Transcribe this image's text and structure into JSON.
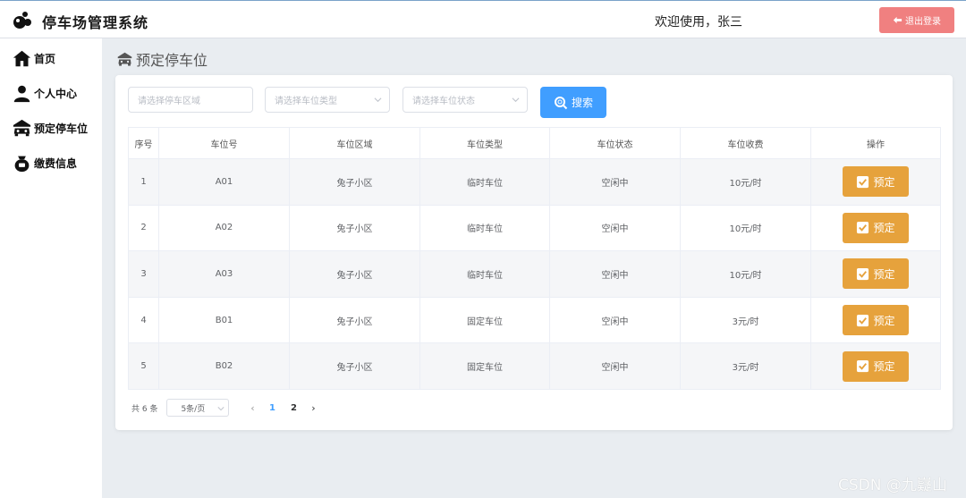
{
  "header": {
    "title": "停车场管理系统",
    "welcome": "欢迎使用，张三",
    "logout_label": "退出登录"
  },
  "sidebar": {
    "items": [
      {
        "label": "首页",
        "icon": "home-icon"
      },
      {
        "label": "个人中心",
        "icon": "user-icon"
      },
      {
        "label": "预定停车位",
        "icon": "car-icon"
      },
      {
        "label": "缴费信息",
        "icon": "wallet-icon"
      }
    ]
  },
  "main": {
    "page_title": "预定停车位",
    "filters": {
      "area_placeholder": "请选择停车区域",
      "type_placeholder": "请选择车位类型",
      "status_placeholder": "请选择车位状态",
      "search_label": "搜索"
    },
    "table": {
      "headers": [
        "序号",
        "车位号",
        "车位区域",
        "车位类型",
        "车位状态",
        "车位收费",
        "操作"
      ],
      "rows": [
        [
          "1",
          "A01",
          "兔子小区",
          "临时车位",
          "空闲中",
          "10元/时"
        ],
        [
          "2",
          "A02",
          "兔子小区",
          "临时车位",
          "空闲中",
          "10元/时"
        ],
        [
          "3",
          "A03",
          "兔子小区",
          "临时车位",
          "空闲中",
          "10元/时"
        ],
        [
          "4",
          "B01",
          "兔子小区",
          "固定车位",
          "空闲中",
          "3元/时"
        ],
        [
          "5",
          "B02",
          "兔子小区",
          "固定车位",
          "空闲中",
          "3元/时"
        ]
      ],
      "action_label": "预定"
    },
    "pagination": {
      "total": "共 6 条",
      "page_size": "5条/页",
      "pages": [
        "1",
        "2"
      ],
      "current_page": "1"
    }
  },
  "watermark": "CSDN @九嶷山",
  "colors": {
    "primary": "#409eff",
    "warning": "#e6a23c",
    "danger_light": "#f08080"
  }
}
